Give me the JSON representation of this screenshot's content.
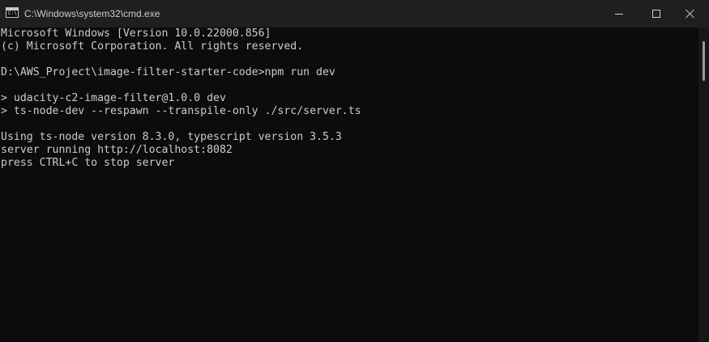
{
  "window": {
    "title": "C:\\Windows\\system32\\cmd.exe",
    "icon": "cmd-icon",
    "icon_prompt": "C:\\",
    "buttons": {
      "minimize": "minimize-icon",
      "maximize": "maximize-icon",
      "close": "close-icon"
    }
  },
  "console": {
    "lines": [
      "Microsoft Windows [Version 10.0.22000.856]",
      "(c) Microsoft Corporation. All rights reserved.",
      "",
      "D:\\AWS_Project\\image-filter-starter-code>npm run dev",
      "",
      "> udacity-c2-image-filter@1.0.0 dev",
      "> ts-node-dev --respawn --transpile-only ./src/server.ts",
      "",
      "Using ts-node version 8.3.0, typescript version 3.5.3",
      "server running http://localhost:8082",
      "press CTRL+C to stop server"
    ]
  },
  "colors": {
    "background": "#0c0c0c",
    "text": "#cccccc",
    "titlebar": "#1f1f1f"
  }
}
